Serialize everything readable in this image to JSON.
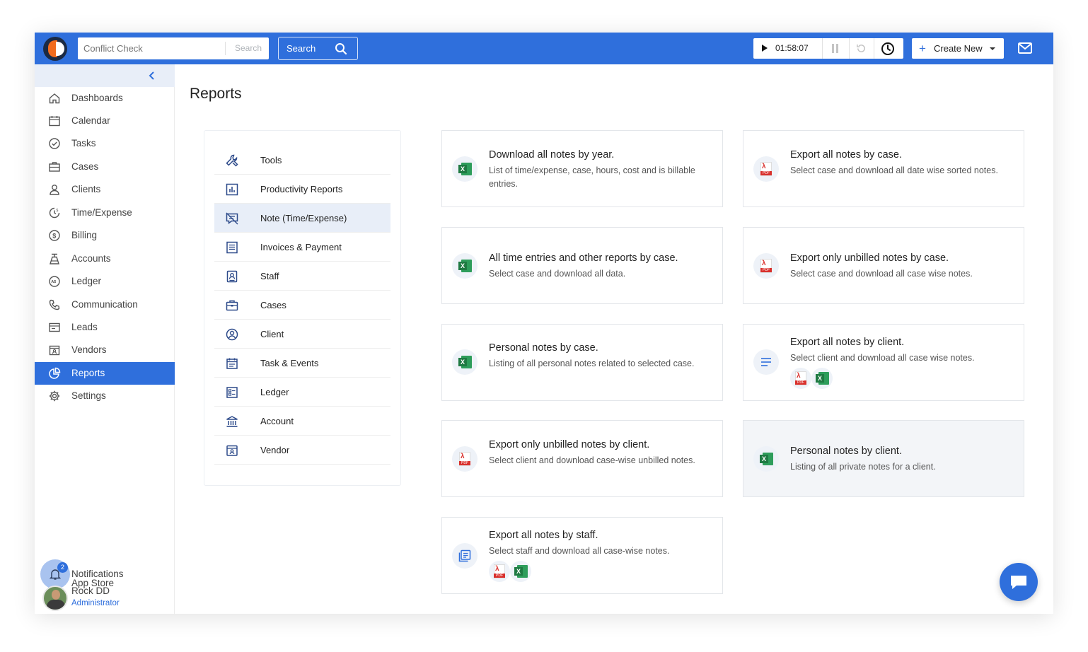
{
  "topbar": {
    "conflict_check_placeholder": "Conflict Check",
    "conflict_check_search": "Search",
    "search_button": "Search",
    "timer_value": "01:58:07",
    "create_new_label": "Create New"
  },
  "sidebar": {
    "items": [
      {
        "label": "Dashboards",
        "icon": "home-icon"
      },
      {
        "label": "Calendar",
        "icon": "calendar-icon"
      },
      {
        "label": "Tasks",
        "icon": "check-circle-icon"
      },
      {
        "label": "Cases",
        "icon": "briefcase-icon"
      },
      {
        "label": "Clients",
        "icon": "person-icon"
      },
      {
        "label": "Time/Expense",
        "icon": "time-expense-icon"
      },
      {
        "label": "Billing",
        "icon": "dollar-circle-icon"
      },
      {
        "label": "Accounts",
        "icon": "accounts-icon"
      },
      {
        "label": "Ledger",
        "icon": "ledger-icon"
      },
      {
        "label": "Communication",
        "icon": "phone-icon"
      },
      {
        "label": "Leads",
        "icon": "leads-icon"
      },
      {
        "label": "Vendors",
        "icon": "vendors-icon"
      },
      {
        "label": "Reports",
        "icon": "reports-pie-icon",
        "active": true
      },
      {
        "label": "Settings",
        "icon": "gear-icon"
      }
    ],
    "app_store": "App Store",
    "notifications": "Notifications",
    "notification_count": "2",
    "user_name": "Rock DD",
    "user_role": "Administrator"
  },
  "main": {
    "title": "Reports",
    "tools": [
      {
        "label": "Tools",
        "icon": "wrench-icon"
      },
      {
        "label": "Productivity Reports",
        "icon": "bar-chart-icon"
      },
      {
        "label": "Note (Time/Expense)",
        "icon": "note-icon",
        "active": true
      },
      {
        "label": "Invoices & Payment",
        "icon": "invoice-icon"
      },
      {
        "label": "Staff",
        "icon": "staff-badge-icon"
      },
      {
        "label": "Cases",
        "icon": "briefcase-icon"
      },
      {
        "label": "Client",
        "icon": "user-circle-icon"
      },
      {
        "label": "Task & Events",
        "icon": "calendar-list-icon"
      },
      {
        "label": "Ledger",
        "icon": "ledger-list-icon"
      },
      {
        "label": "Account",
        "icon": "bank-icon"
      },
      {
        "label": "Vendor",
        "icon": "vendor-calendar-icon"
      }
    ],
    "cards": [
      {
        "title": "Download all notes by year.",
        "desc": "List of time/expense, case, hours, cost and is billable entries.",
        "icon": "excel-icon"
      },
      {
        "title": "Export all notes by case.",
        "desc": "Select case and download all date wise sorted notes.",
        "icon": "pdf-icon"
      },
      {
        "title": "All time entries and other reports by case.",
        "desc": "Select case and download all data.",
        "icon": "excel-icon"
      },
      {
        "title": "Export only unbilled notes by case.",
        "desc": "Select case and download all case wise notes.",
        "icon": "pdf-icon"
      },
      {
        "title": "Personal notes by case.",
        "desc": "Listing of all personal notes related to selected case.",
        "icon": "excel-icon"
      },
      {
        "title": "Export all notes by client.",
        "desc": "Select client and download all case wise notes.",
        "icon": "lines-icon"
      },
      {
        "title": "Export only unbilled notes by client.",
        "desc": "Select client and download case-wise unbilled notes.",
        "icon": "pdf-icon"
      },
      {
        "title": "Personal notes by client.",
        "desc": "Listing of all private notes for a client.",
        "icon": "excel-icon"
      },
      {
        "title": "Export all notes by staff.",
        "desc": "Select staff and download all case-wise notes.",
        "icon": "document-list-icon"
      }
    ]
  },
  "colors": {
    "primary": "#2f6fdc",
    "active_bg": "#e8eef8",
    "excel_green": "#1f7a43",
    "pdf_red": "#d9302c"
  }
}
